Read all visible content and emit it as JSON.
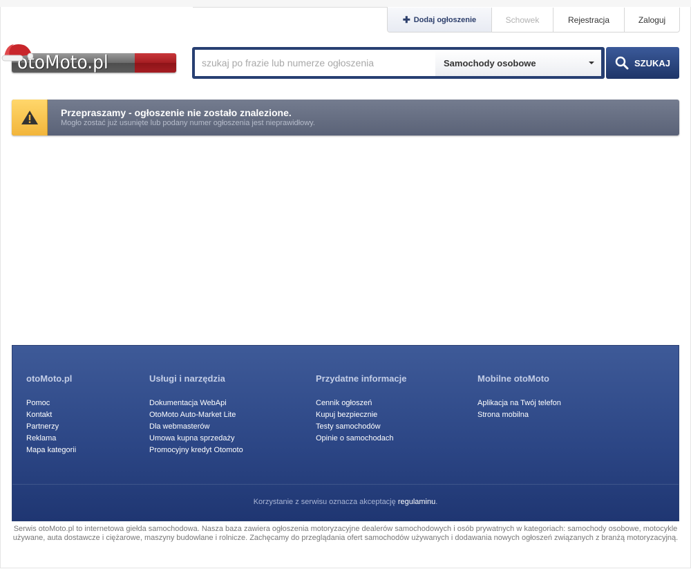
{
  "nav": {
    "add_label": "Dodaj ogłoszenie",
    "clipboard_label": "Schowek",
    "register_label": "Rejestracja",
    "login_label": "Zaloguj"
  },
  "logo": {
    "text": "otoMoto.pl"
  },
  "search": {
    "placeholder": "szukaj po frazie lub numerze ogłoszenia",
    "value": "",
    "category_selected": "Samochody osobowe",
    "button_label": "SZUKAJ"
  },
  "alert": {
    "title": "Przepraszamy - ogłoszenie nie zostało znalezione.",
    "subtitle": "Mogło zostać już usunięte lub podany numer ogłoszenia jest nieprawidłowy."
  },
  "footer": {
    "columns": [
      {
        "heading": "otoMoto.pl",
        "links": [
          "Pomoc",
          "Kontakt",
          "Partnerzy",
          "Reklama",
          "Mapa kategorii"
        ]
      },
      {
        "heading": "Usługi i narzędzia",
        "links": [
          "Dokumentacja WebApi",
          "OtoMoto Auto-Market Lite",
          "Dla webmasterów",
          "Umowa kupna sprzedaży",
          "Promocyjny kredyt Otomoto"
        ]
      },
      {
        "heading": "Przydatne informacje",
        "links": [
          "Cennik ogłoszeń",
          "Kupuj bezpiecznie",
          "Testy samochodów",
          "Opinie o samochodach"
        ]
      },
      {
        "heading": "Mobilne otoMoto",
        "links": [
          "Aplikacja na Twój telefon",
          "Strona mobilna"
        ]
      }
    ],
    "terms_prefix": "Korzystanie z serwisu oznacza akceptację",
    "terms_link": "regulaminu",
    "terms_suffix": "."
  },
  "disclaimer": "Serwis otoMoto.pl to internetowa giełda samochodowa. Nasza baza zawiera ogłoszenia motoryzacyjne dealerów samochodowych i osób prywatnych w kategoriach: samochody osobowe, motocykle używane, auta dostawcze i ciężarowe, maszyny budowlane i rolnicze. Zachęcamy do przeglądania ofert samochodów używanych i dodawania nowych ogłoszeń związanych z branżą motoryzacyjną.",
  "colors": {
    "brand_navy": "#273f72",
    "footer_blue": "#2b4584",
    "alert_gray": "#5a6277",
    "warning_yellow": "#f2b53b",
    "logo_red": "#a51d22"
  }
}
